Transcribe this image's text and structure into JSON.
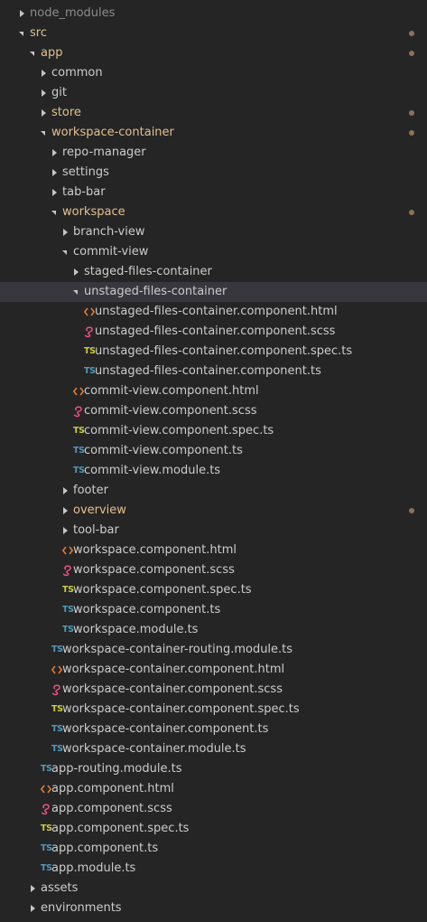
{
  "colors": {
    "background": "#252526",
    "text": "#cccccc",
    "modified_text": "#e2c08d",
    "selected_row": "#37373d",
    "ts_icon": "#519aba",
    "spec_icon": "#cbcb41",
    "html_icon": "#e37933",
    "scss_icon": "#f55385",
    "modified_dot": "#8c7356"
  },
  "tree": [
    {
      "label": "node_modules",
      "kind": "folder",
      "expanded": false,
      "depth": 0,
      "dimmed": true
    },
    {
      "label": "src",
      "kind": "folder",
      "expanded": true,
      "depth": 0,
      "modified": true
    },
    {
      "label": "app",
      "kind": "folder",
      "expanded": true,
      "depth": 1,
      "modified": true
    },
    {
      "label": "common",
      "kind": "folder",
      "expanded": false,
      "depth": 2
    },
    {
      "label": "git",
      "kind": "folder",
      "expanded": false,
      "depth": 2
    },
    {
      "label": "store",
      "kind": "folder",
      "expanded": false,
      "depth": 2,
      "modified": true
    },
    {
      "label": "workspace-container",
      "kind": "folder",
      "expanded": true,
      "depth": 2,
      "modified": true
    },
    {
      "label": "repo-manager",
      "kind": "folder",
      "expanded": false,
      "depth": 3
    },
    {
      "label": "settings",
      "kind": "folder",
      "expanded": false,
      "depth": 3
    },
    {
      "label": "tab-bar",
      "kind": "folder",
      "expanded": false,
      "depth": 3
    },
    {
      "label": "workspace",
      "kind": "folder",
      "expanded": true,
      "depth": 3,
      "modified": true
    },
    {
      "label": "branch-view",
      "kind": "folder",
      "expanded": false,
      "depth": 4
    },
    {
      "label": "commit-view",
      "kind": "folder",
      "expanded": true,
      "depth": 4
    },
    {
      "label": "staged-files-container",
      "kind": "folder",
      "expanded": false,
      "depth": 5
    },
    {
      "label": "unstaged-files-container",
      "kind": "folder",
      "expanded": true,
      "depth": 5,
      "selected": true
    },
    {
      "label": "unstaged-files-container.component.html",
      "kind": "html",
      "depth": 6
    },
    {
      "label": "unstaged-files-container.component.scss",
      "kind": "scss",
      "depth": 6
    },
    {
      "label": "unstaged-files-container.component.spec.ts",
      "kind": "spec",
      "depth": 6
    },
    {
      "label": "unstaged-files-container.component.ts",
      "kind": "ts",
      "depth": 6
    },
    {
      "label": "commit-view.component.html",
      "kind": "html",
      "depth": 5
    },
    {
      "label": "commit-view.component.scss",
      "kind": "scss",
      "depth": 5
    },
    {
      "label": "commit-view.component.spec.ts",
      "kind": "spec",
      "depth": 5
    },
    {
      "label": "commit-view.component.ts",
      "kind": "ts",
      "depth": 5
    },
    {
      "label": "commit-view.module.ts",
      "kind": "ts",
      "depth": 5
    },
    {
      "label": "footer",
      "kind": "folder",
      "expanded": false,
      "depth": 4
    },
    {
      "label": "overview",
      "kind": "folder",
      "expanded": false,
      "depth": 4,
      "modified": true
    },
    {
      "label": "tool-bar",
      "kind": "folder",
      "expanded": false,
      "depth": 4
    },
    {
      "label": "workspace.component.html",
      "kind": "html",
      "depth": 4
    },
    {
      "label": "workspace.component.scss",
      "kind": "scss",
      "depth": 4
    },
    {
      "label": "workspace.component.spec.ts",
      "kind": "spec",
      "depth": 4
    },
    {
      "label": "workspace.component.ts",
      "kind": "ts",
      "depth": 4
    },
    {
      "label": "workspace.module.ts",
      "kind": "ts",
      "depth": 4
    },
    {
      "label": "workspace-container-routing.module.ts",
      "kind": "ts",
      "depth": 3
    },
    {
      "label": "workspace-container.component.html",
      "kind": "html",
      "depth": 3
    },
    {
      "label": "workspace-container.component.scss",
      "kind": "scss",
      "depth": 3
    },
    {
      "label": "workspace-container.component.spec.ts",
      "kind": "spec",
      "depth": 3
    },
    {
      "label": "workspace-container.component.ts",
      "kind": "ts",
      "depth": 3
    },
    {
      "label": "workspace-container.module.ts",
      "kind": "ts",
      "depth": 3
    },
    {
      "label": "app-routing.module.ts",
      "kind": "ts",
      "depth": 2
    },
    {
      "label": "app.component.html",
      "kind": "html",
      "depth": 2
    },
    {
      "label": "app.component.scss",
      "kind": "scss",
      "depth": 2
    },
    {
      "label": "app.component.spec.ts",
      "kind": "spec",
      "depth": 2
    },
    {
      "label": "app.component.ts",
      "kind": "ts",
      "depth": 2
    },
    {
      "label": "app.module.ts",
      "kind": "ts",
      "depth": 2
    },
    {
      "label": "assets",
      "kind": "folder",
      "expanded": false,
      "depth": 1
    },
    {
      "label": "environments",
      "kind": "folder",
      "expanded": false,
      "depth": 1
    }
  ],
  "icons": {
    "ts_text": "TS",
    "folder_collapsed": "chevron-right-icon",
    "folder_expanded": "chevron-down-icon",
    "html": "html-file-icon",
    "scss": "scss-file-icon",
    "ts": "typescript-file-icon",
    "spec": "spec-file-icon"
  }
}
